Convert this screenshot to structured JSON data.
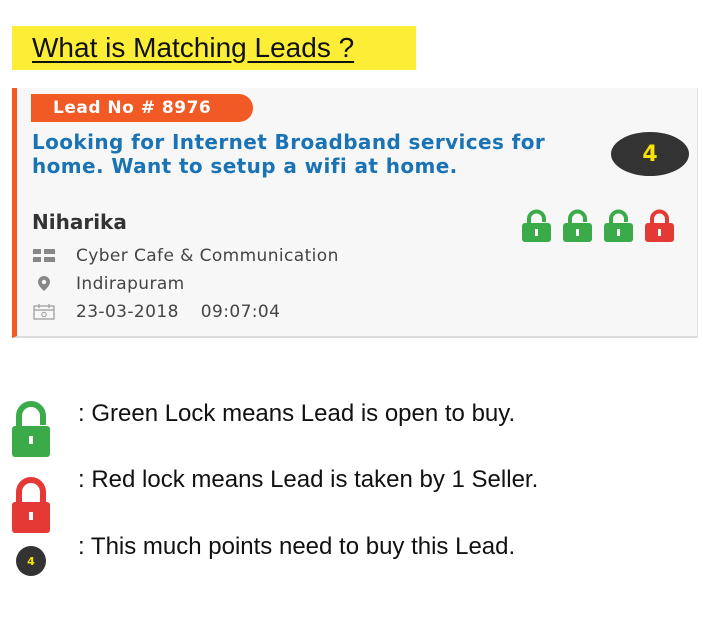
{
  "heading": "What is Matching Leads ?",
  "card": {
    "lead_no": "Lead No # 8976",
    "title": "Looking for Internet Broadband services for home. Want to setup a wifi at home.",
    "points": "4",
    "buyer_name": "Niharika",
    "locks": [
      "green",
      "green",
      "green",
      "red"
    ],
    "category": "Cyber Cafe & Communication",
    "location": "Indirapuram",
    "date": "23-03-2018",
    "time": "09:07:04"
  },
  "legend": {
    "green_lock": ": Green Lock means Lead is open to buy.",
    "red_lock": ": Red lock means Lead is taken by 1 Seller.",
    "points": ": This much points need to buy this Lead.",
    "points_badge_value": "4"
  },
  "colors": {
    "heading_bg": "#fcee37",
    "accent_orange": "#f15a24",
    "title_blue": "#1a73b5",
    "lock_green": "#3bab4a",
    "lock_red": "#e53935",
    "badge_dark": "#333333",
    "badge_text": "#f7e400"
  }
}
